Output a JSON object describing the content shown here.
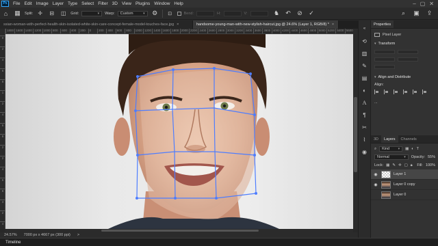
{
  "menubar": {
    "logo": "Ps",
    "items": [
      "File",
      "Edit",
      "Image",
      "Layer",
      "Type",
      "Select",
      "Filter",
      "3D",
      "View",
      "Plugins",
      "Window",
      "Help"
    ]
  },
  "options": {
    "split_label": "Split:",
    "grid_label": "Grid:",
    "warp_label": "Warp:",
    "warp_value": "Custom",
    "bend_label": "Bend:",
    "h_label": "H:",
    "v_label": "V:"
  },
  "tabs": [
    {
      "label": "ssian-woman-with-perfect-health-skin-isolated-white-skin-care-concept-female-model-touches-face.jpg",
      "close": "×"
    },
    {
      "label": "handsome-young-man-with-new-stylish-haircut.jpg @ 24.6% (Layer 1, RGB/8) *",
      "close": "×"
    }
  ],
  "ruler": {
    "h_ticks": [
      "1800",
      "1600",
      "1400",
      "1200",
      "1000",
      "800",
      "600",
      "400",
      "200",
      "0",
      "200",
      "400",
      "600",
      "800",
      "1000",
      "1200",
      "1400",
      "1600",
      "1800",
      "2000",
      "2200",
      "2400",
      "2600",
      "2800",
      "3000",
      "3200",
      "3400",
      "3600",
      "3800",
      "4000",
      "4200",
      "4400",
      "4600",
      "4800",
      "5000",
      "5200",
      "5400",
      "5600"
    ],
    "v_ticks": [
      "0",
      "2",
      "4",
      "6",
      "8",
      "1",
      "2",
      "4",
      "6",
      "8",
      "2",
      "2",
      "4",
      "6",
      "8",
      "3",
      "2",
      "4"
    ]
  },
  "status": {
    "zoom": "24.57%",
    "doc_size": "7000 px x 4667 px (300 ppi)",
    "arrow": ">"
  },
  "timeline": {
    "label": "Timeline"
  },
  "properties": {
    "tab": "Properties",
    "layer_type": "Pixel Layer",
    "transform_title": "Transform",
    "align_title": "Align and Distribute",
    "align_label": "Align:",
    "more": "..."
  },
  "layers": {
    "tabs": [
      "3D",
      "Layers",
      "Channels"
    ],
    "search_placeholder": "Kind",
    "blend_mode": "Normal",
    "opacity_label": "Opacity:",
    "opacity_value": "55%",
    "lock_label": "Lock:",
    "fill_label": "Fill:",
    "fill_value": "100%",
    "items": [
      {
        "name": "Layer 1",
        "visible": true,
        "selected": true,
        "thumb": "transparent"
      },
      {
        "name": "Layer 0 copy",
        "visible": true,
        "selected": false,
        "thumb": "photo"
      },
      {
        "name": "Layer 0",
        "visible": false,
        "selected": false,
        "thumb": "photo"
      }
    ]
  },
  "colors": {
    "warp_grid": "#4d7dff",
    "ui_bg": "#323232",
    "accent": "#31a8ff"
  }
}
